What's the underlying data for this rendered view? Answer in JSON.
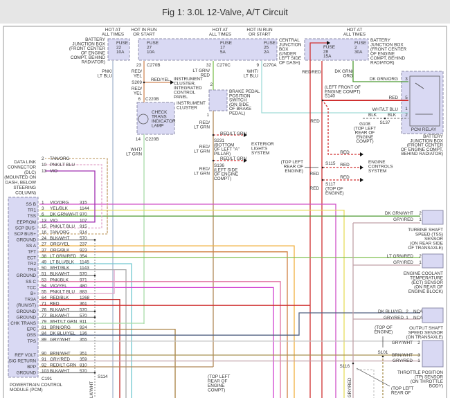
{
  "title": "Fig 1: 3.0L 12-Valve, A/T Circuit",
  "labels": {
    "hot1": [
      "HOT AT",
      "ALL TIMES"
    ],
    "hot2": [
      "HOT IN RUN",
      "OR START"
    ],
    "hot3": [
      "HOT AT",
      "ALL TIMES"
    ],
    "hot4": [
      "HOT IN RUN",
      "OR START"
    ],
    "hot5": [
      "HOT AT",
      "ALL TIMES"
    ],
    "bjb_left": [
      "BATTERY",
      "JUNCTION BOX",
      "(FRONT CENTER",
      "OF ENGINE",
      "COMPT, BEHIND",
      "RADIATOR)"
    ],
    "fuse22": [
      "FUSE",
      "22",
      "10A"
    ],
    "fuse27": [
      "FUSE",
      "27",
      "10A"
    ],
    "fuse17": [
      "FUSE",
      "17",
      "5A"
    ],
    "fuse25": [
      "FUSE",
      "25",
      "2A"
    ],
    "fuse28": [
      "FUSE",
      "28",
      "15A"
    ],
    "fuse2": [
      "FUSE",
      "2",
      "30A"
    ],
    "central_jb": [
      "CENTRAL",
      "JUNCTION",
      "BOX",
      "(UNDER",
      "LEFT SIDE",
      "OF DASH)"
    ],
    "bjb_right": [
      "BATTERY",
      "JUNCTION BOX",
      "(FRONT CENTER",
      "OF ENGINE",
      "COMPT, BEHIND",
      "RADIATOR)"
    ],
    "c270b_pin": [
      "23"
    ],
    "c270b": [
      "C270B"
    ],
    "c270c_pin": [
      "32"
    ],
    "c270c": [
      "C270C"
    ],
    "c270a_pin": [
      "9"
    ],
    "c270a": [
      "C270A"
    ],
    "w_pnk_ltblu": [
      "PNK/",
      "LT BLU"
    ],
    "w_red_yel_1": [
      "RED/",
      "YEL"
    ],
    "s209": [
      "S209"
    ],
    "w_red_yel_h": [
      "RED/YEL"
    ],
    "ic_icp": [
      "INSTRUMENT",
      "CLUSTER,",
      "INTEGRATED",
      "CONTROL",
      "PANEL"
    ],
    "w_red_yel_2": [
      "RED/",
      "YEL"
    ],
    "c220b_top_pin": [
      "6"
    ],
    "c220b_top": [
      "C220B"
    ],
    "ic": [
      "INSTRUMENT",
      "CLUSTER"
    ],
    "lamp": [
      "CHECK",
      "TRANS",
      "INDICATOR",
      "LAMP"
    ],
    "c220b_bot_pin": [
      "14"
    ],
    "c220b_bot": [
      "C220B"
    ],
    "w_wht_ltgrn": [
      "WHT/",
      "LT GRN"
    ],
    "w_ltgrn_red": [
      "LT GRN/",
      "RED"
    ],
    "bpp_pin2": [
      "2"
    ],
    "bpp_pin1": [
      "1"
    ],
    "bpp": [
      "BRAKE PEDAL",
      "POSITION",
      "SWITCH",
      "(ON SIDE",
      "OF BRAKE",
      "PEDAL)"
    ],
    "w_red_ltgrn_1": [
      "RED/",
      "LT GRN"
    ],
    "w_red_ltgrn_h1": [
      "RED/LT GRN"
    ],
    "s231": [
      "S231",
      "(BOTTOM",
      "OF LEFT \"A\"",
      "PILLAR)"
    ],
    "w_red_ltgrn_2": [
      "RED/",
      "LT GRN"
    ],
    "w_red_ltgrn_h2": [
      "RED/LT GRN"
    ],
    "s136": [
      "S136",
      "(LEFT SIDE",
      "OF ENGINE",
      "COMPT)"
    ],
    "w_red_ltgrn_3": [
      "RED/",
      "LT GRN"
    ],
    "ext_lights": [
      "EXTERIOR",
      "LIGHTS",
      "SYSTEM"
    ],
    "w_wht_ltblu": [
      "WHT/",
      "LT BLU"
    ],
    "w_red_a": [
      "RED"
    ],
    "w_red_b": [
      "RED"
    ],
    "w_dkgrn_org": [
      "DK GRN/",
      "ORG"
    ],
    "s140": [
      "(LEFT FRONT OF",
      "ENGINE COMPT)",
      "S140"
    ],
    "relay_dkgrn": [
      "DK GRN/ORG"
    ],
    "relay_red": [
      "RED"
    ],
    "relay_whtltblu": [
      "WHT/LT BLU"
    ],
    "blk1": [
      "BLK"
    ],
    "blk2": [
      "BLK"
    ],
    "relay_pin3": [
      "3"
    ],
    "relay_pin5": [
      "5"
    ],
    "relay_pin1": [
      "1"
    ],
    "relay_pin2": [
      "2"
    ],
    "g108": [
      "G108",
      "(TOP LEFT",
      "REAR OF",
      "ENGINE",
      "COMPT)"
    ],
    "s137": [
      "S137"
    ],
    "pcm_relay": [
      "PCM RELAY"
    ],
    "bjb_right_bottom": [
      "BATTERY",
      "JUNCTION BOX",
      "(FRONT CENTER",
      "OF ENGINE COMPT,",
      "BEHIND RADIATOR)"
    ],
    "w_red_c": [
      "RED"
    ],
    "ec_red1": [
      "RED"
    ],
    "ec_red2": [
      "RED"
    ],
    "ec_red3": [
      "RED"
    ],
    "top_left_rear_engine": [
      "(TOP LEFT",
      "REAR OF",
      "ENGINE)"
    ],
    "s115": [
      "S115"
    ],
    "w_red_d": [
      "RED"
    ],
    "w_red_e": [
      "RED"
    ],
    "s117": [
      "S117",
      "(TOP OF",
      "ENGINE)"
    ],
    "engine_controls": [
      "ENGINE",
      "CONTROLS",
      "SYSTEM"
    ],
    "dlc": [
      "DATA LINK",
      "CONNECTOR",
      "(DLC)",
      "(MOUNTED ON",
      "DASH, BELOW",
      "STEERING",
      "COLUMN)"
    ],
    "tss_w2": [
      "DK GRN/WHT"
    ],
    "tss_p2": [
      "2"
    ],
    "tss_w1": [
      "GRY/RED"
    ],
    "tss_p1": [
      "1"
    ],
    "tss": [
      "TURBINE SHAFT",
      "SPEED (TSS)",
      "SENSOR",
      "(ON REAR SIDE",
      "OF TRANSAXLE)"
    ],
    "ect_w2": [
      "LT GRN/RED"
    ],
    "ect_p2": [
      "2"
    ],
    "ect_w1": [
      "GRY/RED"
    ],
    "ect_p1": [
      "1"
    ],
    "ect": [
      "ENGINE COOLANT",
      "TEMPERATURE",
      "(ECT) SENSOR",
      "(ON REAR OF",
      "ENGINE BLOCK)"
    ],
    "oss_w2": [
      "DK BLU/YEL"
    ],
    "oss_p2": [
      "2"
    ],
    "oss_nca2": [
      "NCA"
    ],
    "oss_w1": [
      "GRY/RED"
    ],
    "oss_p1": [
      "1"
    ],
    "oss_nca1": [
      "NCA"
    ],
    "oss": [
      "OUTPUT SHAFT",
      "SPEED SENSOR",
      "(ON TRANSAXLE)"
    ],
    "top_of_engine": [
      "(TOP OF",
      "ENGINE)"
    ],
    "s101": [
      "S101"
    ],
    "tps_w2": [
      "GRY/WHT"
    ],
    "tps_p2": [
      "2"
    ],
    "tps_w3": [
      "BRN/WHT"
    ],
    "tps_p3": [
      "3"
    ],
    "tps_w1": [
      "GRY/RED"
    ],
    "tps_p1": [
      "1"
    ],
    "tps": [
      "THROTTLE POSITION",
      "(TP) SENSOR",
      "(ON THROTTLE",
      "BODY)"
    ],
    "s116": [
      "S116"
    ],
    "top_left_rear_of": [
      "(TOP LEFT",
      "REAR OF"
    ],
    "s114": [
      "S114"
    ],
    "c191": [
      "C191"
    ],
    "pcm_name": [
      "POWERTRAIN CONTROL",
      "MODULE (PCM)"
    ],
    "top_left_rear_compt": [
      "(TOP LEFT",
      "REAR OF",
      "ENGINE",
      "COMPT)"
    ]
  },
  "vertical_labels": {
    "s116_gry_red": "GRY/RED",
    "s114_blk_wht": "BLK/WHT"
  },
  "dlc_rows": [
    {
      "pin": "2",
      "wire": "TAN/ORG"
    },
    {
      "pin": "10",
      "wire": "PNK/LT BLU"
    },
    {
      "pin": "13",
      "wire": "VIO"
    }
  ],
  "pcm_rows": [
    {
      "pin": "1",
      "wire": "VIO/ORG",
      "circuit": "315",
      "function": "SS B"
    },
    {
      "pin": "3",
      "wire": "YEL/BLK",
      "circuit": "1144",
      "function": "TR1"
    },
    {
      "pin": "6",
      "wire": "DK GRN/WHT",
      "circuit": "970",
      "function": "TSS"
    },
    {
      "pin": "13",
      "wire": "VIO",
      "circuit": "107",
      "function": "EEPROM"
    },
    {
      "pin": "15",
      "wire": "PNK/LT BLU",
      "circuit": "915",
      "function": "SCP BUS-"
    },
    {
      "pin": "16",
      "wire": "TAN/ORG",
      "circuit": "914",
      "function": "SCP BUS+"
    },
    {
      "pin": "24",
      "wire": "BLK/WHT",
      "circuit": "570",
      "function": "GROUND"
    },
    {
      "pin": "27",
      "wire": "ORG/YEL",
      "circuit": "237",
      "function": "SS A"
    },
    {
      "pin": "37",
      "wire": "ORG/BLK",
      "circuit": "923",
      "function": "TFT"
    },
    {
      "pin": "38",
      "wire": "LT GRN/RED",
      "circuit": "354",
      "function": "ECT"
    },
    {
      "pin": "49",
      "wire": "LT BLU/BLK",
      "circuit": "1145",
      "function": "TR2"
    },
    {
      "pin": "50",
      "wire": "WHT/BLK",
      "circuit": "1143",
      "function": "TR4"
    },
    {
      "pin": "51",
      "wire": "BLK/WHT",
      "circuit": "570",
      "function": "GROUND"
    },
    {
      "pin": "53",
      "wire": "PNK/BLK",
      "circuit": "971",
      "function": "SS C"
    },
    {
      "pin": "54",
      "wire": "VIO/YEL",
      "circuit": "480",
      "function": "TCC"
    },
    {
      "pin": "55",
      "wire": "PNK/LT BLU",
      "circuit": "883",
      "function": "B+"
    },
    {
      "pin": "64",
      "wire": "RED/BLK",
      "circuit": "1268",
      "function": "TR3A"
    },
    {
      "pin": "71",
      "wire": "RED",
      "circuit": "361",
      "function": "(RUN/ST)"
    },
    {
      "pin": "76",
      "wire": "BLK/WHT",
      "circuit": "570",
      "function": "GROUND"
    },
    {
      "pin": "77",
      "wire": "BLK/WHT",
      "circuit": "570",
      "function": "GROUND"
    },
    {
      "pin": "79",
      "wire": "WHT/LT GRN",
      "circuit": "911",
      "function": "CHK TRANS"
    },
    {
      "pin": "81",
      "wire": "BRN/ORG",
      "circuit": "924",
      "function": "EPC"
    },
    {
      "pin": "84",
      "wire": "DK BLU/YEL",
      "circuit": "136",
      "function": "OSS"
    },
    {
      "pin": "89",
      "wire": "GRY/WHT",
      "circuit": "355",
      "function": "TPS"
    },
    {
      "pin": "90",
      "wire": "BRN/WHT",
      "circuit": "351",
      "function": "REF VOLT"
    },
    {
      "pin": "91",
      "wire": "GRY/RED",
      "circuit": "359",
      "function": "SIG RETURN"
    },
    {
      "pin": "92",
      "wire": "RED/LT GRN",
      "circuit": "810",
      "function": "BPP"
    },
    {
      "pin": "103",
      "wire": "BLK/WHT",
      "circuit": "570",
      "function": "GROUND"
    }
  ],
  "wire_colors": {
    "VIO/ORG": "#d050c8",
    "YEL/BLK": "#e6dc5a",
    "DK GRN/WHT": "#5aa040",
    "VIO": "#a030b0",
    "PNK/LT BLU": "#e0a0c8",
    "TAN/ORG": "#c8a878",
    "BLK/WHT": "#808080",
    "ORG/YEL": "#f0b040",
    "ORG/BLK": "#d08040",
    "LT GRN/RED": "#80c050",
    "LT BLU/BLK": "#70c8d0",
    "WHT/BLK": "#a8a8a8",
    "PNK/BLK": "#e070a0",
    "VIO/YEL": "#d040d0",
    "RED/BLK": "#c02828",
    "RED": "#d03030",
    "WHT/LT GRN": "#a8dca8",
    "BRN/ORG": "#a88040",
    "DK BLU/YEL": "#506080",
    "GRY/WHT": "#c4c4c4",
    "BRN/WHT": "#a89050",
    "GRY/RED": "#c0a0a8",
    "RED/LT GRN": "#b08858",
    "RED/YEL": "#d08858",
    "WHT/LT BLU": "#a0dcd8",
    "DK GRN/ORG": "#4a9a30",
    "BLK": "#666666"
  },
  "component_fill": "#d9d9f3"
}
